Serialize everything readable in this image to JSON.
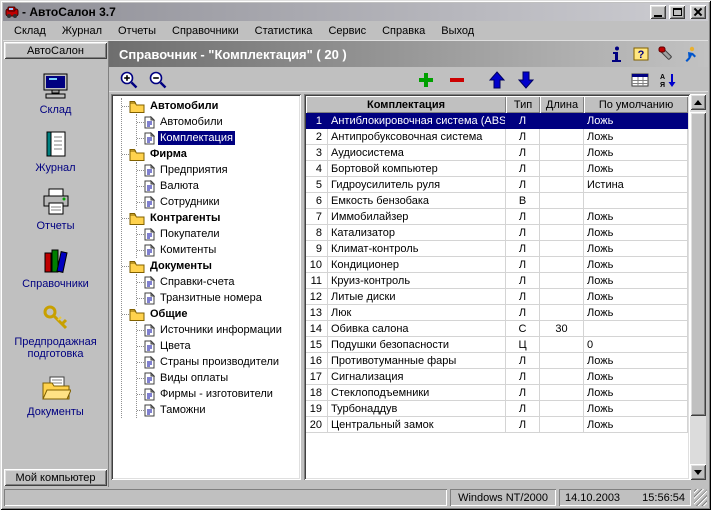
{
  "window": {
    "title": "- АвтоСалон 3.7"
  },
  "menu": {
    "items": [
      "Склад",
      "Журнал",
      "Отчеты",
      "Справочники",
      "Статистика",
      "Сервис",
      "Справка",
      "Выход"
    ]
  },
  "sidebar": {
    "top_button": "АвтоСалон",
    "bottom_button": "Мой компьютер",
    "items": [
      {
        "label": "Склад",
        "icon": "warehouse-computer-icon"
      },
      {
        "label": "Журнал",
        "icon": "journal-icon"
      },
      {
        "label": "Отчеты",
        "icon": "reports-printer-icon"
      },
      {
        "label": "Справочники",
        "icon": "directories-books-icon"
      },
      {
        "label": "Предпродажная подготовка",
        "icon": "presale-keys-icon"
      },
      {
        "label": "Документы",
        "icon": "documents-folder-icon"
      }
    ]
  },
  "header": {
    "title": "Справочник - \"Комплектация\" ( 20 )",
    "icons": [
      "info-icon",
      "help-icon",
      "settings-icon",
      "exit-icon"
    ]
  },
  "toolbar": {
    "icons": [
      "zoom-in-icon",
      "zoom-out-icon",
      "add-record-icon",
      "delete-record-icon",
      "move-up-icon",
      "move-down-icon",
      "grid-icon",
      "sort-icon"
    ]
  },
  "tree": {
    "selected": "Комплектация",
    "groups": [
      {
        "label": "Автомобили",
        "children": [
          "Автомобили",
          "Комплектация"
        ]
      },
      {
        "label": "Фирма",
        "children": [
          "Предприятия",
          "Валюта",
          "Сотрудники"
        ]
      },
      {
        "label": "Контрагенты",
        "children": [
          "Покупатели",
          "Комитенты"
        ]
      },
      {
        "label": "Документы",
        "children": [
          "Справки-счета",
          "Транзитные номера"
        ]
      },
      {
        "label": "Общие",
        "children": [
          "Источники информации",
          "Цвета",
          "Страны производители",
          "Виды оплаты",
          "Фирмы - изготовители",
          "Таможни"
        ]
      }
    ]
  },
  "table": {
    "columns": [
      "Комплектация",
      "Тип",
      "Длина",
      "По умолчанию"
    ],
    "rows": [
      {
        "num": 1,
        "name": "Антиблокировочная система (ABS)",
        "type": "Л",
        "length": "",
        "default": "Ложь",
        "selected": true
      },
      {
        "num": 2,
        "name": "Антипробуксовочная система",
        "type": "Л",
        "length": "",
        "default": "Ложь"
      },
      {
        "num": 3,
        "name": "Аудиосистема",
        "type": "Л",
        "length": "",
        "default": "Ложь"
      },
      {
        "num": 4,
        "name": "Бортовой компьютер",
        "type": "Л",
        "length": "",
        "default": "Ложь"
      },
      {
        "num": 5,
        "name": "Гидроусилитель руля",
        "type": "Л",
        "length": "",
        "default": "Истина"
      },
      {
        "num": 6,
        "name": "Емкость бензобака",
        "type": "В",
        "length": "",
        "default": ""
      },
      {
        "num": 7,
        "name": "Иммобилайзер",
        "type": "Л",
        "length": "",
        "default": "Ложь"
      },
      {
        "num": 8,
        "name": "Катализатор",
        "type": "Л",
        "length": "",
        "default": "Ложь"
      },
      {
        "num": 9,
        "name": "Климат-контроль",
        "type": "Л",
        "length": "",
        "default": "Ложь"
      },
      {
        "num": 10,
        "name": "Кондиционер",
        "type": "Л",
        "length": "",
        "default": "Ложь"
      },
      {
        "num": 11,
        "name": "Круиз-контроль",
        "type": "Л",
        "length": "",
        "default": "Ложь"
      },
      {
        "num": 12,
        "name": "Литые диски",
        "type": "Л",
        "length": "",
        "default": "Ложь"
      },
      {
        "num": 13,
        "name": "Люк",
        "type": "Л",
        "length": "",
        "default": "Ложь"
      },
      {
        "num": 14,
        "name": "Обивка салона",
        "type": "С",
        "length": "30",
        "default": ""
      },
      {
        "num": 15,
        "name": "Подушки безопасности",
        "type": "Ц",
        "length": "",
        "default": "0"
      },
      {
        "num": 16,
        "name": "Противотуманные фары",
        "type": "Л",
        "length": "",
        "default": "Ложь"
      },
      {
        "num": 17,
        "name": "Сигнализация",
        "type": "Л",
        "length": "",
        "default": "Ложь"
      },
      {
        "num": 18,
        "name": "Стеклоподъемники",
        "type": "Л",
        "length": "",
        "default": "Ложь"
      },
      {
        "num": 19,
        "name": "Турбонаддув",
        "type": "Л",
        "length": "",
        "default": "Ложь"
      },
      {
        "num": 20,
        "name": "Центральный замок",
        "type": "Л",
        "length": "",
        "default": "Ложь"
      }
    ]
  },
  "statusbar": {
    "os": "Windows NT/2000",
    "date": "14.10.2003",
    "time": "15:56:54"
  }
}
